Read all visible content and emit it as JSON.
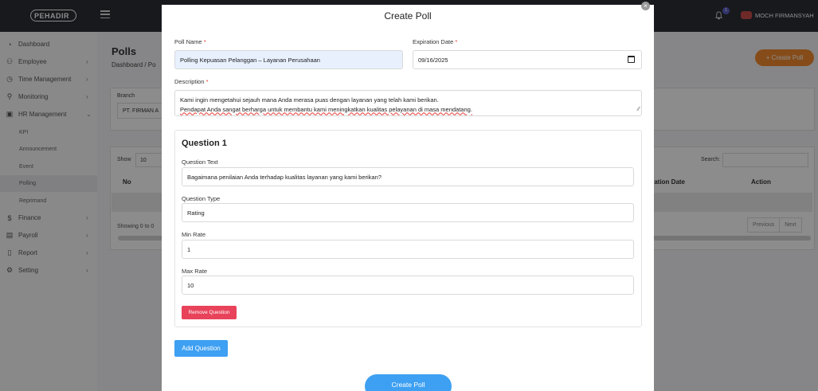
{
  "app": {
    "logo_text": "PEHADIR",
    "user_name": "MOCH FIRMANSYAH",
    "notification_count": "1"
  },
  "sidebar": {
    "items": [
      {
        "label": "Dashboard",
        "icon": "dashboard-icon"
      },
      {
        "label": "Employee",
        "icon": "users-icon"
      },
      {
        "label": "Time Management",
        "icon": "clock-icon"
      },
      {
        "label": "Monitoring",
        "icon": "location-icon"
      },
      {
        "label": "HR Management",
        "icon": "briefcase-icon"
      },
      {
        "label": "Finance",
        "icon": "dollar-icon"
      },
      {
        "label": "Payroll",
        "icon": "payroll-icon"
      },
      {
        "label": "Report",
        "icon": "document-icon"
      },
      {
        "label": "Setting",
        "icon": "gear-icon"
      }
    ],
    "sub_items": [
      "KPI",
      "Announcement",
      "Event",
      "Polling",
      "Reprimand"
    ]
  },
  "page": {
    "title": "Polls",
    "breadcrumb": "Dashboard / Po",
    "create_button": "+ Create Poll",
    "branch_label": "Branch",
    "branch_value": "PT. FIRMAN A",
    "show_label": "Show",
    "show_value": "10",
    "search_label": "Search:",
    "col_no": "No",
    "col_expiration": "iration Date",
    "col_action": "Action",
    "showing_text": "Showing 0 to 0",
    "prev": "Previous",
    "next": "Next"
  },
  "modal": {
    "title": "Create Poll",
    "close_glyph": "×",
    "poll_name_label": "Poll Name",
    "poll_name_value": "Polling Kepuasan Pelanggan – Layanan Perusahaan",
    "expiration_label": "Expiration Date",
    "expiration_value": "09/16/2025",
    "description_label": "Description",
    "description_lines": [
      "Kami ingin mengetahui sejauh mana Anda merasa puas dengan layanan yang telah kami berikan.",
      "Pendapat Anda sangat berharga untuk membantu kami meningkatkan kualitas pelayanan di masa mendatang."
    ],
    "required_mark": "*",
    "question": {
      "title": "Question 1",
      "text_label": "Question Text",
      "text_value": "Bagaimana penilaian Anda terhadap kualitas layanan yang kami berikan?",
      "type_label": "Question Type",
      "type_value": "Rating",
      "min_label": "Min Rate",
      "min_value": "1",
      "max_label": "Max Rate",
      "max_value": "10",
      "remove_button": "Remove Question"
    },
    "add_question_button": "Add Question",
    "submit_button": "Create Poll"
  },
  "colors": {
    "primary": "#3ea0f2",
    "danger": "#e8435a",
    "accent_orange": "#f28b30",
    "topbar": "#2b2f35"
  }
}
